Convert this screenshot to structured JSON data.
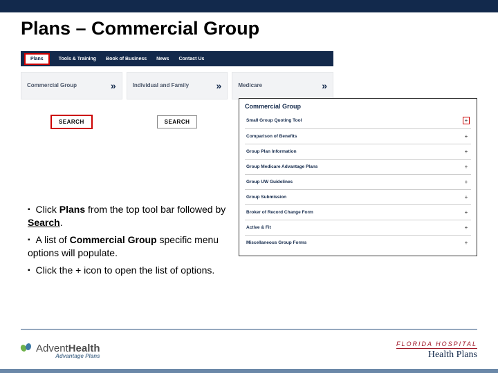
{
  "title": "Plans – Commercial Group",
  "nav": {
    "items": [
      "Plans",
      "Tools & Training",
      "Book of Business",
      "News",
      "Contact Us"
    ]
  },
  "planCards": [
    {
      "label": "Commercial Group"
    },
    {
      "label": "Individual and Family"
    },
    {
      "label": "Medicare"
    }
  ],
  "buttons": {
    "search": "SEARCH"
  },
  "cgPanel": {
    "title": "Commercial Group",
    "rows": [
      "Small Group Quoting Tool",
      "Comparison of Benefits",
      "Group Plan Information",
      "Group Medicare Advantage Plans",
      "Group UW Guidelines",
      "Group Submission",
      "Broker of Record Change Form",
      "Active & Fit",
      "Miscellaneous Group Forms"
    ]
  },
  "instructions": {
    "i1a": "Click ",
    "i1b": "Plans",
    "i1c": " from the top tool bar followed by ",
    "i1d": "Search",
    "i1e": ".",
    "i2a": "A list of ",
    "i2b": "Commercial Group",
    "i2c": " specific menu options will populate.",
    "i3": "Click the + icon to open the list of options."
  },
  "footer": {
    "ahAdv": "Advent",
    "ahHlth": "Health",
    "ahSub": "Advantage Plans",
    "hfTop": "FLORIDA HOSPITAL",
    "hfMain": "Health Plans"
  },
  "glyphs": {
    "chevrons": "»",
    "plus": "+"
  }
}
